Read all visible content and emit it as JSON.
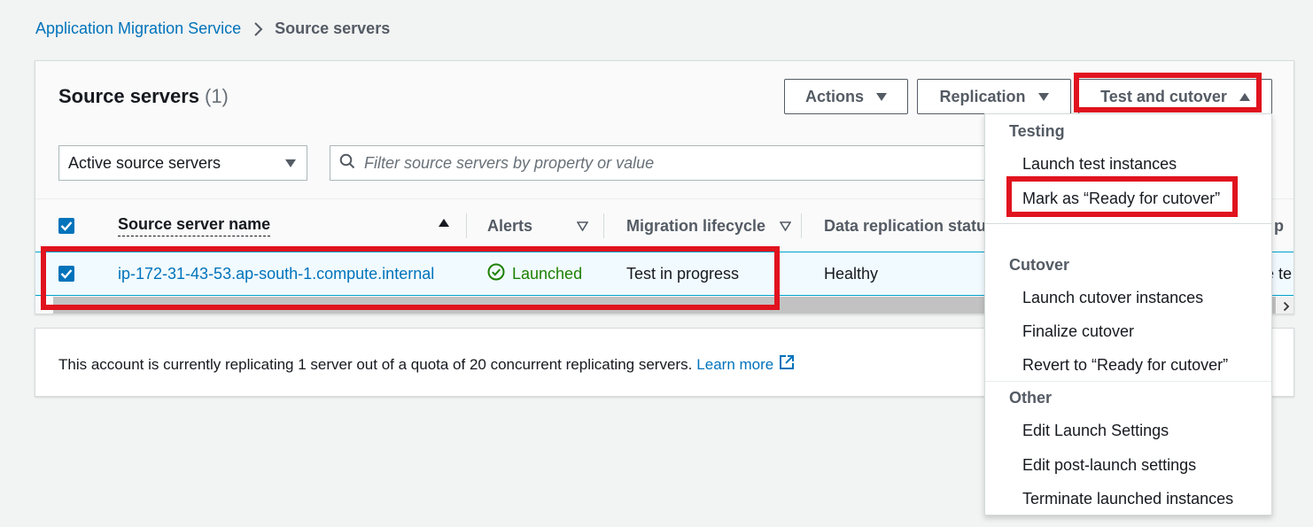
{
  "breadcrumb": {
    "parent": "Application Migration Service",
    "current": "Source servers"
  },
  "panel": {
    "title": "Source servers",
    "count": "(1)",
    "buttons": {
      "actions": "Actions",
      "replication": "Replication",
      "test_cutover": "Test and cutover"
    },
    "filter_select": {
      "value": "Active source servers"
    },
    "search": {
      "placeholder": "Filter source servers by property or value"
    }
  },
  "table": {
    "headers": {
      "name": "Source server name",
      "alerts": "Alerts",
      "lifecycle": "Migration lifecycle",
      "replication_status": "Data replication status",
      "edge_header": "p"
    },
    "rows": [
      {
        "selected": true,
        "name": "ip-172-31-43-53.ap-south-1.compute.internal",
        "alert": "Launched",
        "lifecycle": "Test in progress",
        "replication_status": "Healthy",
        "edge_text": "e te"
      }
    ]
  },
  "quota": {
    "text": "This account is currently replicating 1 server out of a quota of 20 concurrent replicating servers.",
    "link": "Learn more"
  },
  "dropdown": {
    "testing_header": "Testing",
    "testing": [
      "Launch test instances",
      "Mark as “Ready for cutover”"
    ],
    "cutover_header": "Cutover",
    "cutover": [
      "Launch cutover instances",
      "Finalize cutover",
      "Revert to “Ready for cutover”"
    ],
    "other_header": "Other",
    "other": [
      "Edit Launch Settings",
      "Edit post-launch settings",
      "Terminate launched instances"
    ]
  },
  "colors": {
    "link": "#0073bb",
    "success": "#1d8102",
    "highlight": "#e0131e",
    "selected_row": "#f1faff"
  },
  "icons": [
    "chevron-right-icon",
    "caret-down-icon",
    "caret-up-icon",
    "search-icon",
    "checkbox-checked-icon",
    "status-success-icon",
    "external-link-icon",
    "scroll-right-icon"
  ]
}
